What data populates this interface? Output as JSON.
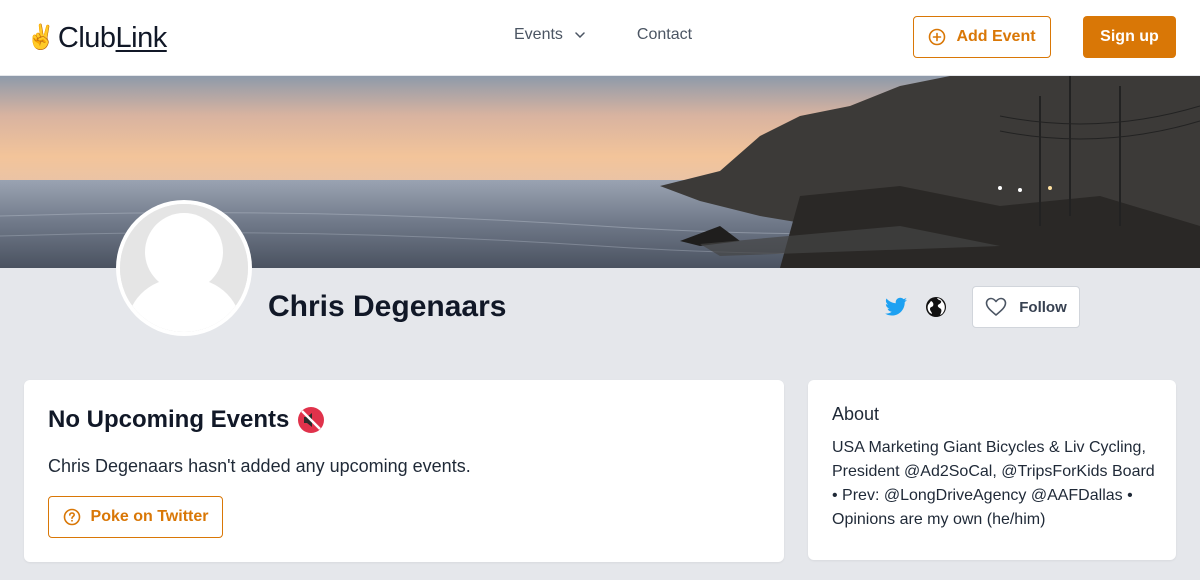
{
  "header": {
    "logo_emoji": "✌️",
    "logo_text_main": "Club",
    "logo_text_link": "Link",
    "nav": {
      "events_label": "Events",
      "contact_label": "Contact"
    },
    "add_event_label": "Add Event",
    "signup_label": "Sign up"
  },
  "profile": {
    "name": "Chris Degenaars",
    "follow_label": "Follow"
  },
  "events_card": {
    "title": "No Upcoming Events",
    "message": "Chris Degenaars hasn't added any upcoming events.",
    "poke_label": "Poke on Twitter"
  },
  "about_card": {
    "title": "About",
    "text": "USA Marketing Giant Bicycles & Liv Cycling, President @Ad2SoCal, @TripsForKids Board • Prev: @LongDriveAgency @AAFDallas • Opinions are my own (he/him)"
  },
  "colors": {
    "accent": "#d97706",
    "twitter": "#1da1f2",
    "background": "#e5e7eb"
  },
  "icons": [
    "plus-circle-icon",
    "chevron-down-icon",
    "twitter-icon",
    "globe-icon",
    "heart-icon",
    "muted-speaker-icon",
    "question-circle-icon",
    "avatar-placeholder-icon"
  ]
}
